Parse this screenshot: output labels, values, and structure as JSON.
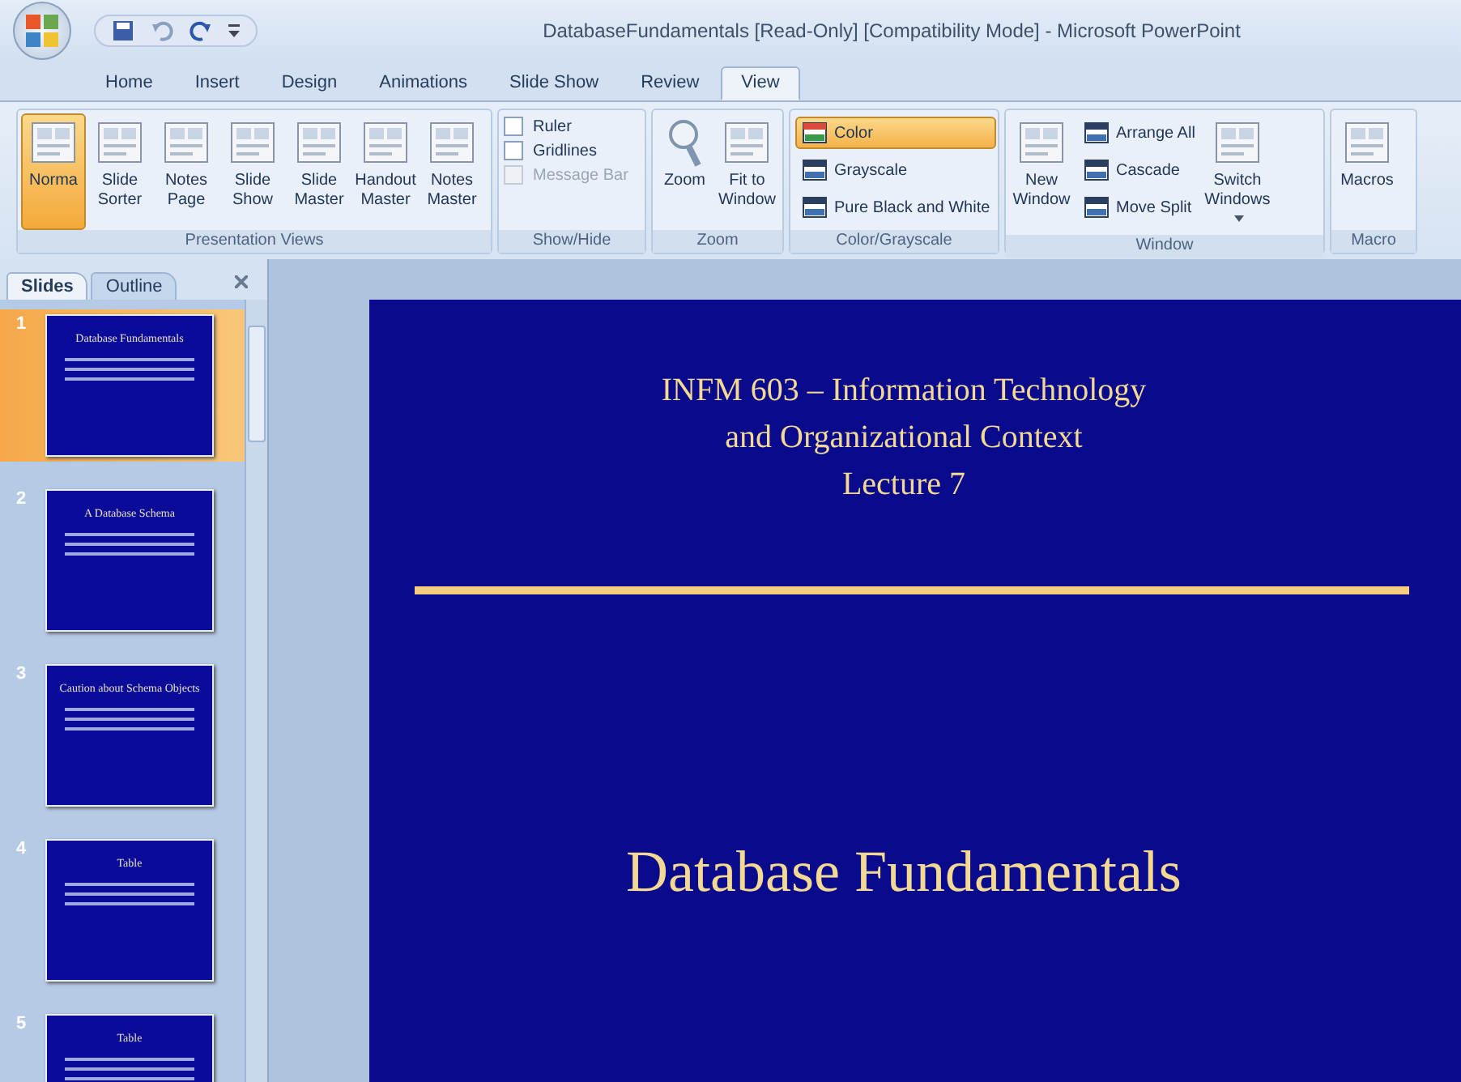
{
  "window": {
    "title": "DatabaseFundamentals [Read-Only] [Compatibility Mode] - Microsoft PowerPoint"
  },
  "tabs": [
    {
      "label": "Home",
      "selected": false
    },
    {
      "label": "Insert",
      "selected": false
    },
    {
      "label": "Design",
      "selected": false
    },
    {
      "label": "Animations",
      "selected": false
    },
    {
      "label": "Slide Show",
      "selected": false
    },
    {
      "label": "Review",
      "selected": false
    },
    {
      "label": "View",
      "selected": true
    }
  ],
  "ribbon": {
    "groups": [
      {
        "name": "Presentation Views",
        "items": [
          {
            "kind": "large",
            "label": "Norma",
            "selected": true,
            "dropdown": false
          },
          {
            "kind": "large",
            "label": "Slide Sorter",
            "selected": false,
            "dropdown": false
          },
          {
            "kind": "large",
            "label": "Notes Page",
            "selected": false,
            "dropdown": false
          },
          {
            "kind": "large",
            "label": "Slide Show",
            "selected": false,
            "dropdown": false
          },
          {
            "kind": "large",
            "label": "Slide Master",
            "selected": false,
            "dropdown": false
          },
          {
            "kind": "large",
            "label": "Handout Master",
            "selected": false,
            "dropdown": false
          },
          {
            "kind": "large",
            "label": "Notes Master",
            "selected": false,
            "dropdown": false
          }
        ]
      },
      {
        "name": "Show/Hide",
        "items": [
          {
            "kind": "check",
            "label": "Ruler",
            "checked": false,
            "disabled": false
          },
          {
            "kind": "check",
            "label": "Gridlines",
            "checked": false,
            "disabled": false
          },
          {
            "kind": "check",
            "label": "Message Bar",
            "checked": false,
            "disabled": true
          }
        ]
      },
      {
        "name": "Zoom",
        "items": [
          {
            "kind": "large",
            "label": "Zoom",
            "selected": false,
            "dropdown": false
          },
          {
            "kind": "large",
            "label": "Fit to Window",
            "selected": false,
            "dropdown": false
          }
        ]
      },
      {
        "name": "Color/Grayscale",
        "items": [
          {
            "kind": "small",
            "label": "Color",
            "selected": true
          },
          {
            "kind": "small",
            "label": "Grayscale",
            "selected": false
          },
          {
            "kind": "small",
            "label": "Pure Black and White",
            "selected": false
          }
        ]
      },
      {
        "name": "Window",
        "items": [
          {
            "kind": "large",
            "label": "New Window",
            "selected": false,
            "dropdown": false
          },
          {
            "kind": "small",
            "label": "Arrange All",
            "selected": false
          },
          {
            "kind": "small",
            "label": "Cascade",
            "selected": false
          },
          {
            "kind": "small",
            "label": "Move Split",
            "selected": false
          },
          {
            "kind": "large",
            "label": "Switch Windows",
            "selected": false,
            "dropdown": true
          }
        ]
      },
      {
        "name": "Macro",
        "items": [
          {
            "kind": "large",
            "label": "Macros",
            "selected": false,
            "dropdown": false
          }
        ]
      }
    ]
  },
  "slides_pane": {
    "tabs": [
      {
        "label": "Slides",
        "selected": true
      },
      {
        "label": "Outline",
        "selected": false
      }
    ],
    "thumbnails": [
      {
        "number": "1",
        "title": "Database Fundamentals",
        "selected": true
      },
      {
        "number": "2",
        "title": "A Database Schema",
        "selected": false
      },
      {
        "number": "3",
        "title": "Caution about Schema Objects",
        "selected": false
      },
      {
        "number": "4",
        "title": "Table",
        "selected": false
      },
      {
        "number": "5",
        "title": "Table",
        "selected": false
      }
    ]
  },
  "slide": {
    "heading_lines": [
      "INFM 603 – Information Technology",
      "and Organizational Context",
      "Lecture 7"
    ],
    "title": "Database Fundamentals"
  }
}
